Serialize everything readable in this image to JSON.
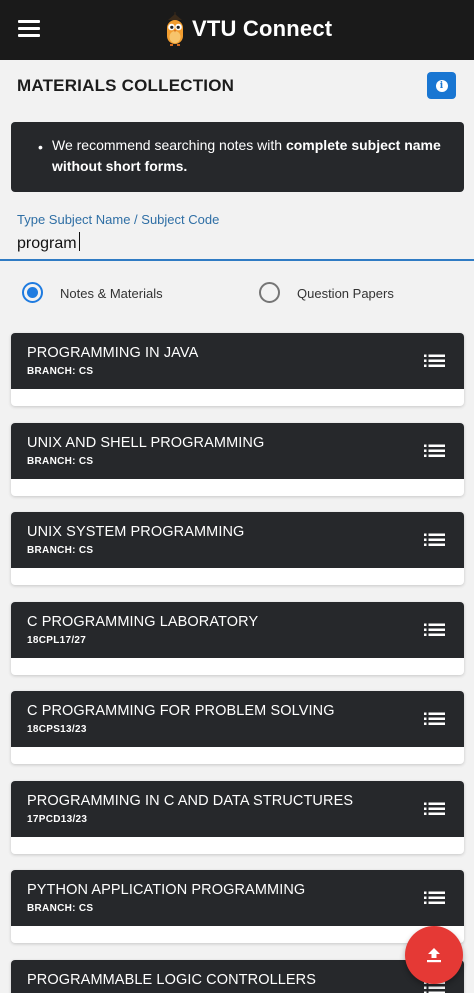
{
  "app": {
    "name": "VTU Connect"
  },
  "header": {
    "title": "MATERIALS COLLECTION"
  },
  "tip": {
    "prefix": "We recommend searching notes with ",
    "bold": "complete subject name without short forms."
  },
  "search": {
    "label": "Type Subject Name / Subject Code",
    "value": "program"
  },
  "filter": {
    "selected": "notes",
    "options": [
      {
        "id": "notes",
        "label": "Notes & Materials"
      },
      {
        "id": "papers",
        "label": "Question Papers"
      }
    ]
  },
  "results": [
    {
      "title": "PROGRAMMING IN JAVA",
      "subtitle": "BRANCH: CS"
    },
    {
      "title": "UNIX AND SHELL PROGRAMMING",
      "subtitle": "BRANCH: CS"
    },
    {
      "title": "UNIX SYSTEM PROGRAMMING",
      "subtitle": "BRANCH: CS"
    },
    {
      "title": "C PROGRAMMING LABORATORY",
      "subtitle": "18CPL17/27"
    },
    {
      "title": "C PROGRAMMING FOR PROBLEM SOLVING",
      "subtitle": "18CPS13/23"
    },
    {
      "title": "PROGRAMMING IN C AND DATA STRUCTURES",
      "subtitle": "17PCD13/23"
    },
    {
      "title": "PYTHON APPLICATION PROGRAMMING",
      "subtitle": "BRANCH: CS"
    },
    {
      "title": "PROGRAMMABLE LOGIC CONTROLLERS",
      "subtitle": ""
    }
  ],
  "icons": {
    "menu": "hamburger-icon",
    "info": "info-icon",
    "list": "list-icon",
    "upload": "upload-icon",
    "logo": "owl-logo-icon"
  },
  "colors": {
    "topbar": "#1a1a1a",
    "card_header": "#26282b",
    "accent_blue": "#1976d2",
    "fab_red": "#e53935"
  }
}
